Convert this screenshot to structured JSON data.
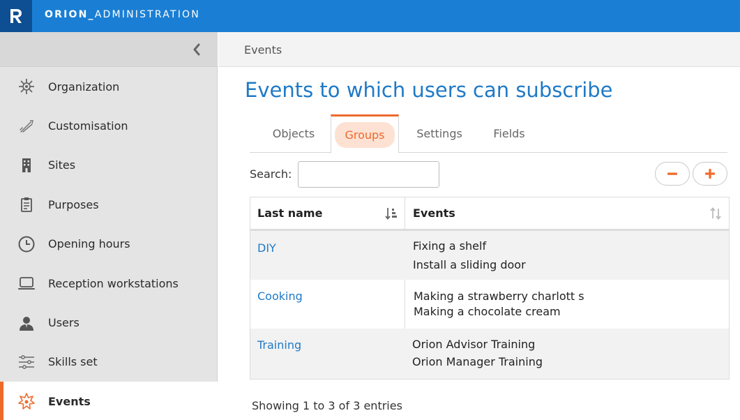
{
  "app": {
    "title_bold": "ORION_",
    "title_rest": "ADMINISTRATION",
    "logo_letter": "R"
  },
  "sidebar": {
    "items": [
      {
        "label": "Organization",
        "icon": "organization-icon"
      },
      {
        "label": "Customisation",
        "icon": "brush-icon"
      },
      {
        "label": "Sites",
        "icon": "building-icon"
      },
      {
        "label": "Purposes",
        "icon": "clipboard-icon"
      },
      {
        "label": "Opening hours",
        "icon": "clock-icon"
      },
      {
        "label": "Reception workstations",
        "icon": "laptop-icon"
      },
      {
        "label": "Users",
        "icon": "user-icon"
      },
      {
        "label": "Skills set",
        "icon": "sliders-icon"
      },
      {
        "label": "Events",
        "icon": "events-star-icon",
        "active": true
      }
    ]
  },
  "main": {
    "breadcrumb": "Events",
    "title": "Events to which users can subscribe",
    "tabs": [
      {
        "label": "Objects"
      },
      {
        "label": "Groups",
        "active": true
      },
      {
        "label": "Settings"
      },
      {
        "label": "Fields"
      }
    ],
    "search": {
      "label": "Search:",
      "value": ""
    },
    "table": {
      "columns": [
        "Last name",
        "Events"
      ],
      "rows": [
        {
          "name": "DIY",
          "events": [
            "Fixing a shelf",
            "Install a sliding door"
          ]
        },
        {
          "name": "Cooking",
          "events": [
            "Making a strawberry charlott s",
            "Making a chocolate cream"
          ]
        },
        {
          "name": "Training",
          "events": [
            "Orion Advisor Training",
            "Orion Manager Training"
          ]
        }
      ]
    },
    "footer": "Showing 1 to 3 of 3 entries"
  },
  "colors": {
    "topbar": "#1a7fd4",
    "logo_bg": "#0e4e92",
    "accent": "#ee6a2a",
    "link": "#1f7ac6",
    "sidebar_bg": "#e4e4e4"
  }
}
